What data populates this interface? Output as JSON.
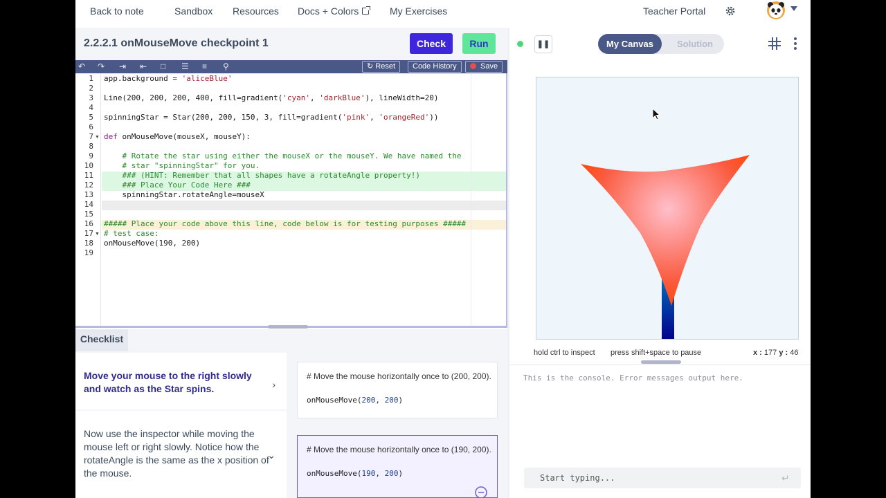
{
  "nav": {
    "back": "Back to note",
    "sandbox": "Sandbox",
    "resources": "Resources",
    "docs": "Docs + Colors",
    "exercises": "My Exercises",
    "teacher": "Teacher Portal"
  },
  "header": {
    "title": "2.2.2.1 onMouseMove checkpoint 1",
    "check": "Check",
    "run": "Run"
  },
  "toolbar": {
    "reset": "Reset",
    "history": "Code History",
    "save": "Save"
  },
  "editor": {
    "lines": [
      "1",
      "2",
      "3",
      "4",
      "5",
      "6",
      "7",
      "8",
      "9",
      "10",
      "11",
      "12",
      "13",
      "14",
      "15",
      "16",
      "17",
      "18",
      "19"
    ]
  },
  "checklist": {
    "tab": "Checklist",
    "task1": "Move your mouse to the right slowly and watch as the Star spins.",
    "task2": "Now use the inspector while moving the mouse left or right slowly. Notice how the rotateAngle is the same as the x position of the mouse.",
    "card1_comment": "# Move the mouse horizontally once to (200, 200).",
    "card1_fn": "onMouseMove(",
    "card1_a": "200",
    "card1_b": "200",
    "card2_comment": "# Move the mouse horizontally once to (190, 200).",
    "card2_fn": "onMouseMove(",
    "card2_a": "190",
    "card2_b": "200"
  },
  "canvas": {
    "tab_canvas": "My Canvas",
    "tab_solution": "Solution",
    "hint_inspect": "hold ctrl to inspect",
    "hint_pause": "press shift+space to pause",
    "x_label": "x :",
    "x_value": "177",
    "y_label": "y :",
    "y_value": "46"
  },
  "console": {
    "output": "This is the console. Error messages output here.",
    "placeholder": "Start typing..."
  },
  "colors": {
    "accent": "#3e26dd",
    "run": "#5fe69a",
    "toolbar": "#4a5887",
    "canvas_bg": "#eef6fb"
  }
}
